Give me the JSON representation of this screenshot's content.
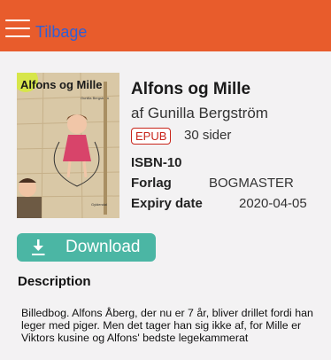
{
  "header": {
    "back_label": "Tilbage",
    "bar_color": "#e85c2c",
    "icons": {
      "menu": "hamburger-menu-icon"
    }
  },
  "book": {
    "cover": {
      "title_text": "Alfons og Mille",
      "small_author_text": "Gunilla Bergström",
      "publisher_text": "Gyldendal"
    },
    "title": "Alfons og Mille",
    "author": "af Gunilla Bergström",
    "format_badge": "EPUB",
    "format_color": "#c8251b",
    "pages": "30 sider",
    "isbn_label": "ISBN-10",
    "publisher_label": "Forlag",
    "publisher_value": "BOGMASTER",
    "expiry_label": "Expiry date",
    "expiry_value": "2020-04-05"
  },
  "actions": {
    "download_label": "Download",
    "download_color": "#4bb6a4",
    "download_icon": "download-arrow-icon"
  },
  "description": {
    "heading": "Description",
    "text": "Billedbog. Alfons Åberg, der nu er 7 år, bliver drillet fordi han leger med piger. Men det tager han sig ikke af, for Mille er Viktors kusine og Alfons' bedste legekammerat"
  }
}
